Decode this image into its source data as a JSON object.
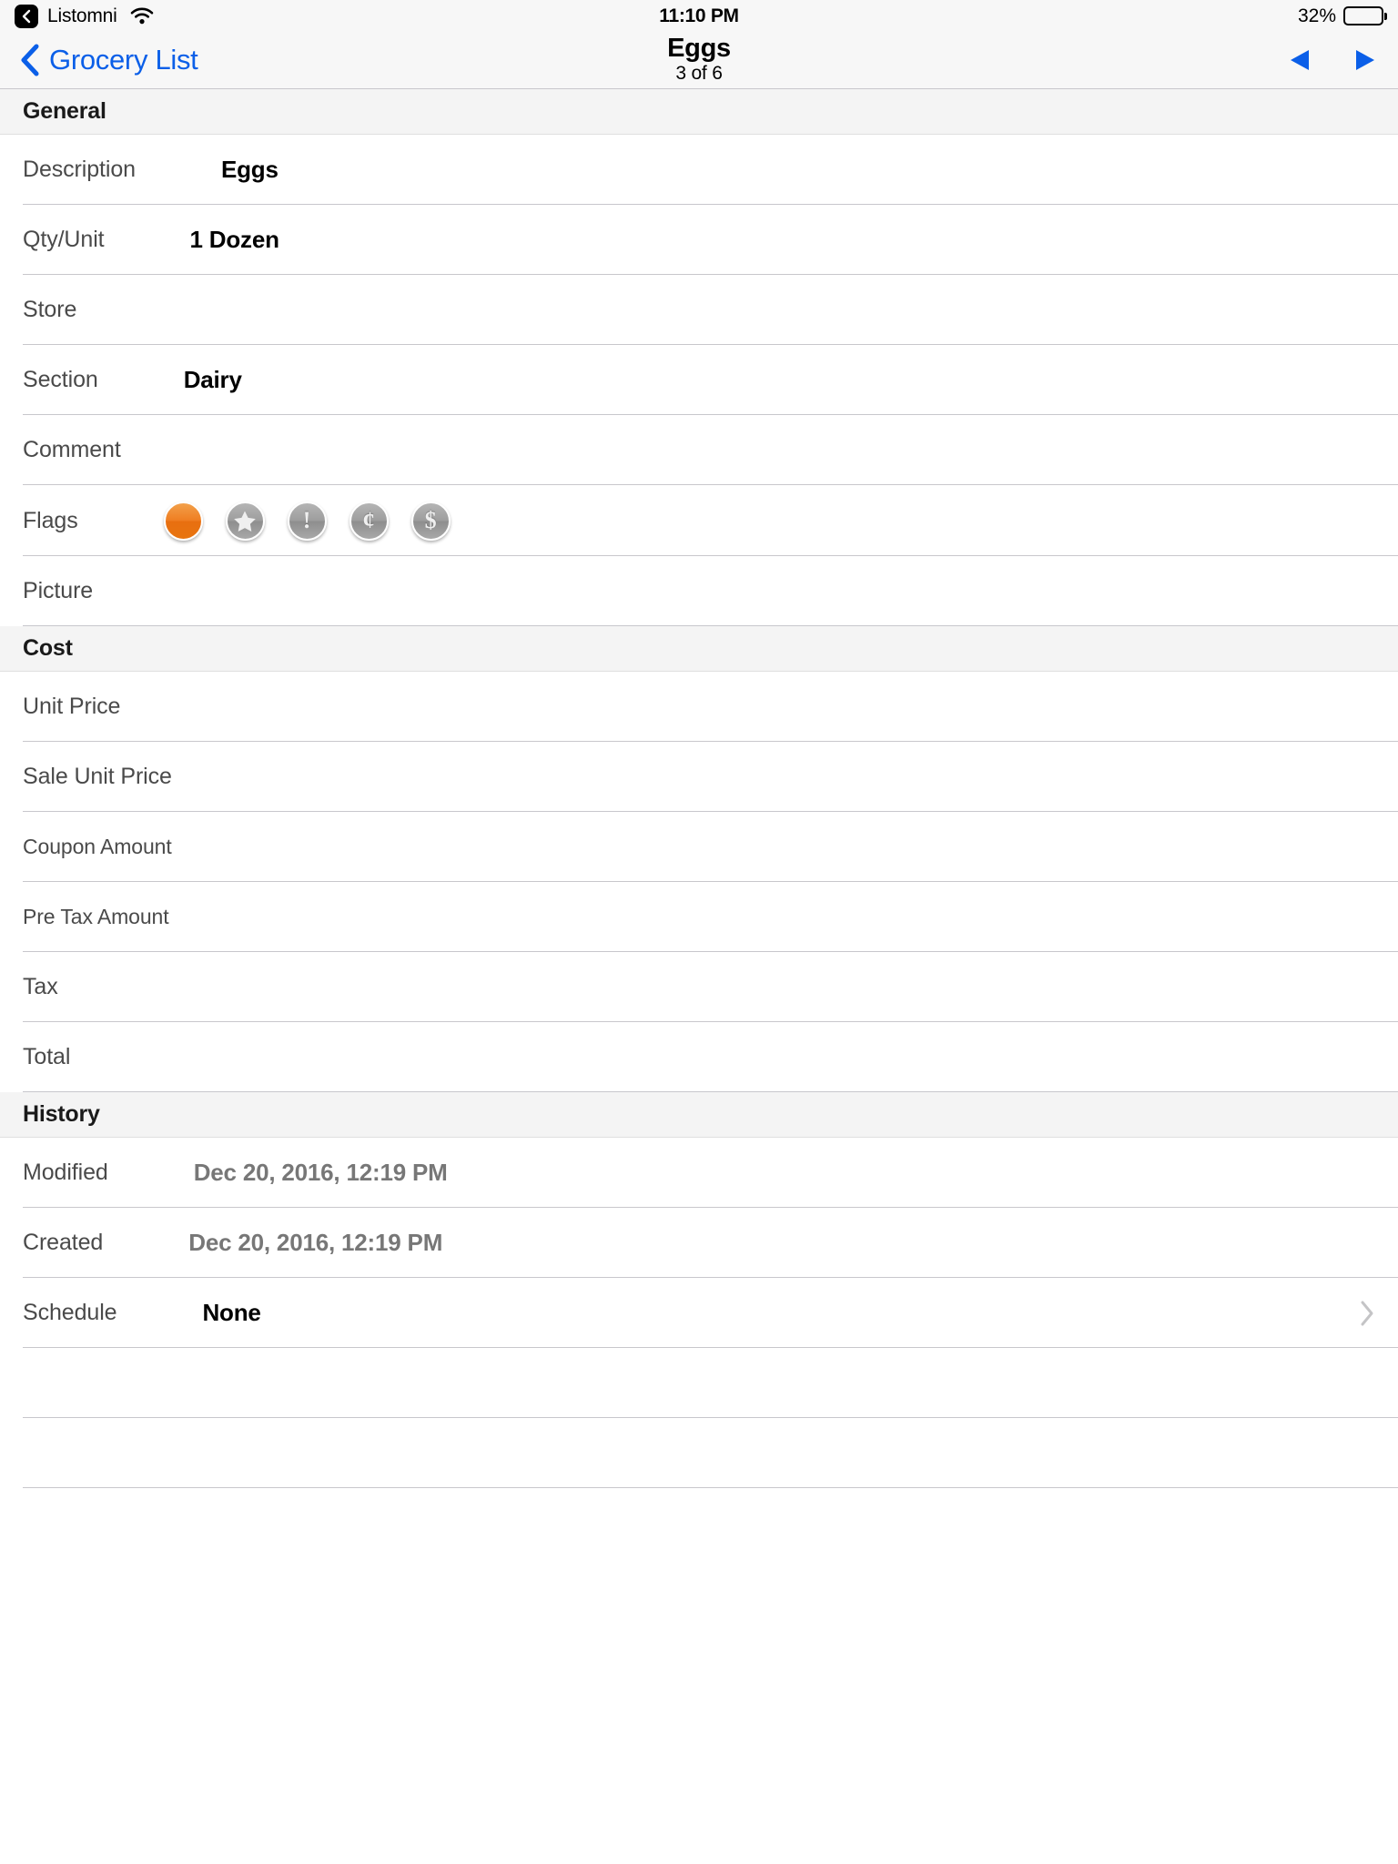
{
  "status_bar": {
    "back_app_label": "Listomni",
    "back_icon": "back-chevron-icon",
    "wifi_icon": "wifi-icon",
    "time": "11:10 PM",
    "battery_percent": "32%",
    "battery_level": 32,
    "battery_icon": "battery-icon"
  },
  "nav_bar": {
    "back_label": "Grocery List",
    "back_icon": "chevron-left-icon",
    "title": "Eggs",
    "subtitle": "3 of 6",
    "prev_icon": "triangle-left-icon",
    "next_icon": "triangle-right-icon",
    "accent_color": "#0b5fe8"
  },
  "sections": [
    {
      "header": "General",
      "rows": [
        {
          "label": "Description",
          "value": "Eggs",
          "type": "text"
        },
        {
          "label": "Qty/Unit",
          "value": "1 Dozen",
          "type": "text"
        },
        {
          "label": "Store",
          "value": "",
          "type": "text"
        },
        {
          "label": "Section",
          "value": "Dairy",
          "type": "text"
        },
        {
          "label": "Comment",
          "value": "",
          "type": "text"
        },
        {
          "label": "Flags",
          "value": "",
          "type": "flags"
        },
        {
          "label": "Picture",
          "value": "",
          "type": "picture"
        }
      ]
    },
    {
      "header": "Cost",
      "rows": [
        {
          "label": "Unit Price",
          "value": "",
          "type": "text"
        },
        {
          "label": "Sale Unit Price",
          "value": "",
          "type": "text"
        },
        {
          "label": "Coupon Amount",
          "value": "",
          "type": "text",
          "small": true
        },
        {
          "label": "Pre Tax Amount",
          "value": "",
          "type": "text",
          "small": true
        },
        {
          "label": "Tax",
          "value": "",
          "type": "text"
        },
        {
          "label": "Total",
          "value": "",
          "type": "text"
        }
      ]
    },
    {
      "header": "History",
      "rows": [
        {
          "label": "Modified",
          "value": "Dec 20, 2016, 12:19 PM",
          "type": "muted"
        },
        {
          "label": "Created",
          "value": "Dec 20, 2016, 12:19 PM",
          "type": "muted"
        },
        {
          "label": "Schedule",
          "value": "None",
          "type": "disclosure"
        }
      ]
    }
  ],
  "flags": [
    {
      "name": "flag-circle-orange",
      "glyph": "",
      "active": true,
      "icon": "circle-icon"
    },
    {
      "name": "flag-star",
      "glyph": "",
      "active": false,
      "icon": "star-icon"
    },
    {
      "name": "flag-exclamation",
      "glyph": "!",
      "active": false,
      "icon": "exclamation-icon"
    },
    {
      "name": "flag-cent",
      "glyph": "¢",
      "active": false,
      "icon": "cent-icon"
    },
    {
      "name": "flag-dollar",
      "glyph": "$",
      "active": false,
      "icon": "dollar-icon"
    }
  ],
  "colors": {
    "accent": "#0b5fe8",
    "flag_active": "#e8740f",
    "flag_inactive": "#9e9e9e",
    "section_bg": "#f4f4f4",
    "separator": "#c8c7cc"
  }
}
